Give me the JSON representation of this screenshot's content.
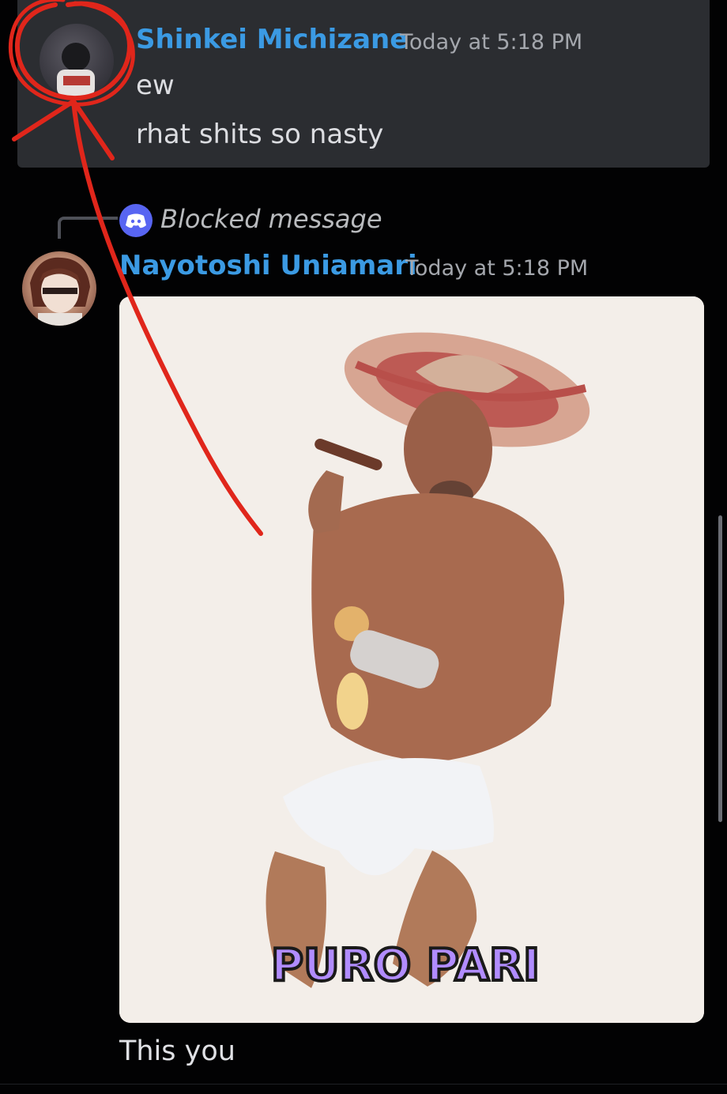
{
  "messages": {
    "first": {
      "username": "Shinkei Michizane",
      "timestamp": "Today at 5:18 PM",
      "lines": [
        "ew",
        "rhat shits so nasty"
      ]
    },
    "reply": {
      "blocked_label": "Blocked message"
    },
    "second": {
      "username": "Nayotoshi Uniamari",
      "timestamp": "Today at 5:18 PM",
      "image_caption_text": "PURO PARI",
      "caption": "This you"
    }
  },
  "colors": {
    "username": "#3b9ae3",
    "annotation_red": "#e0261b"
  }
}
